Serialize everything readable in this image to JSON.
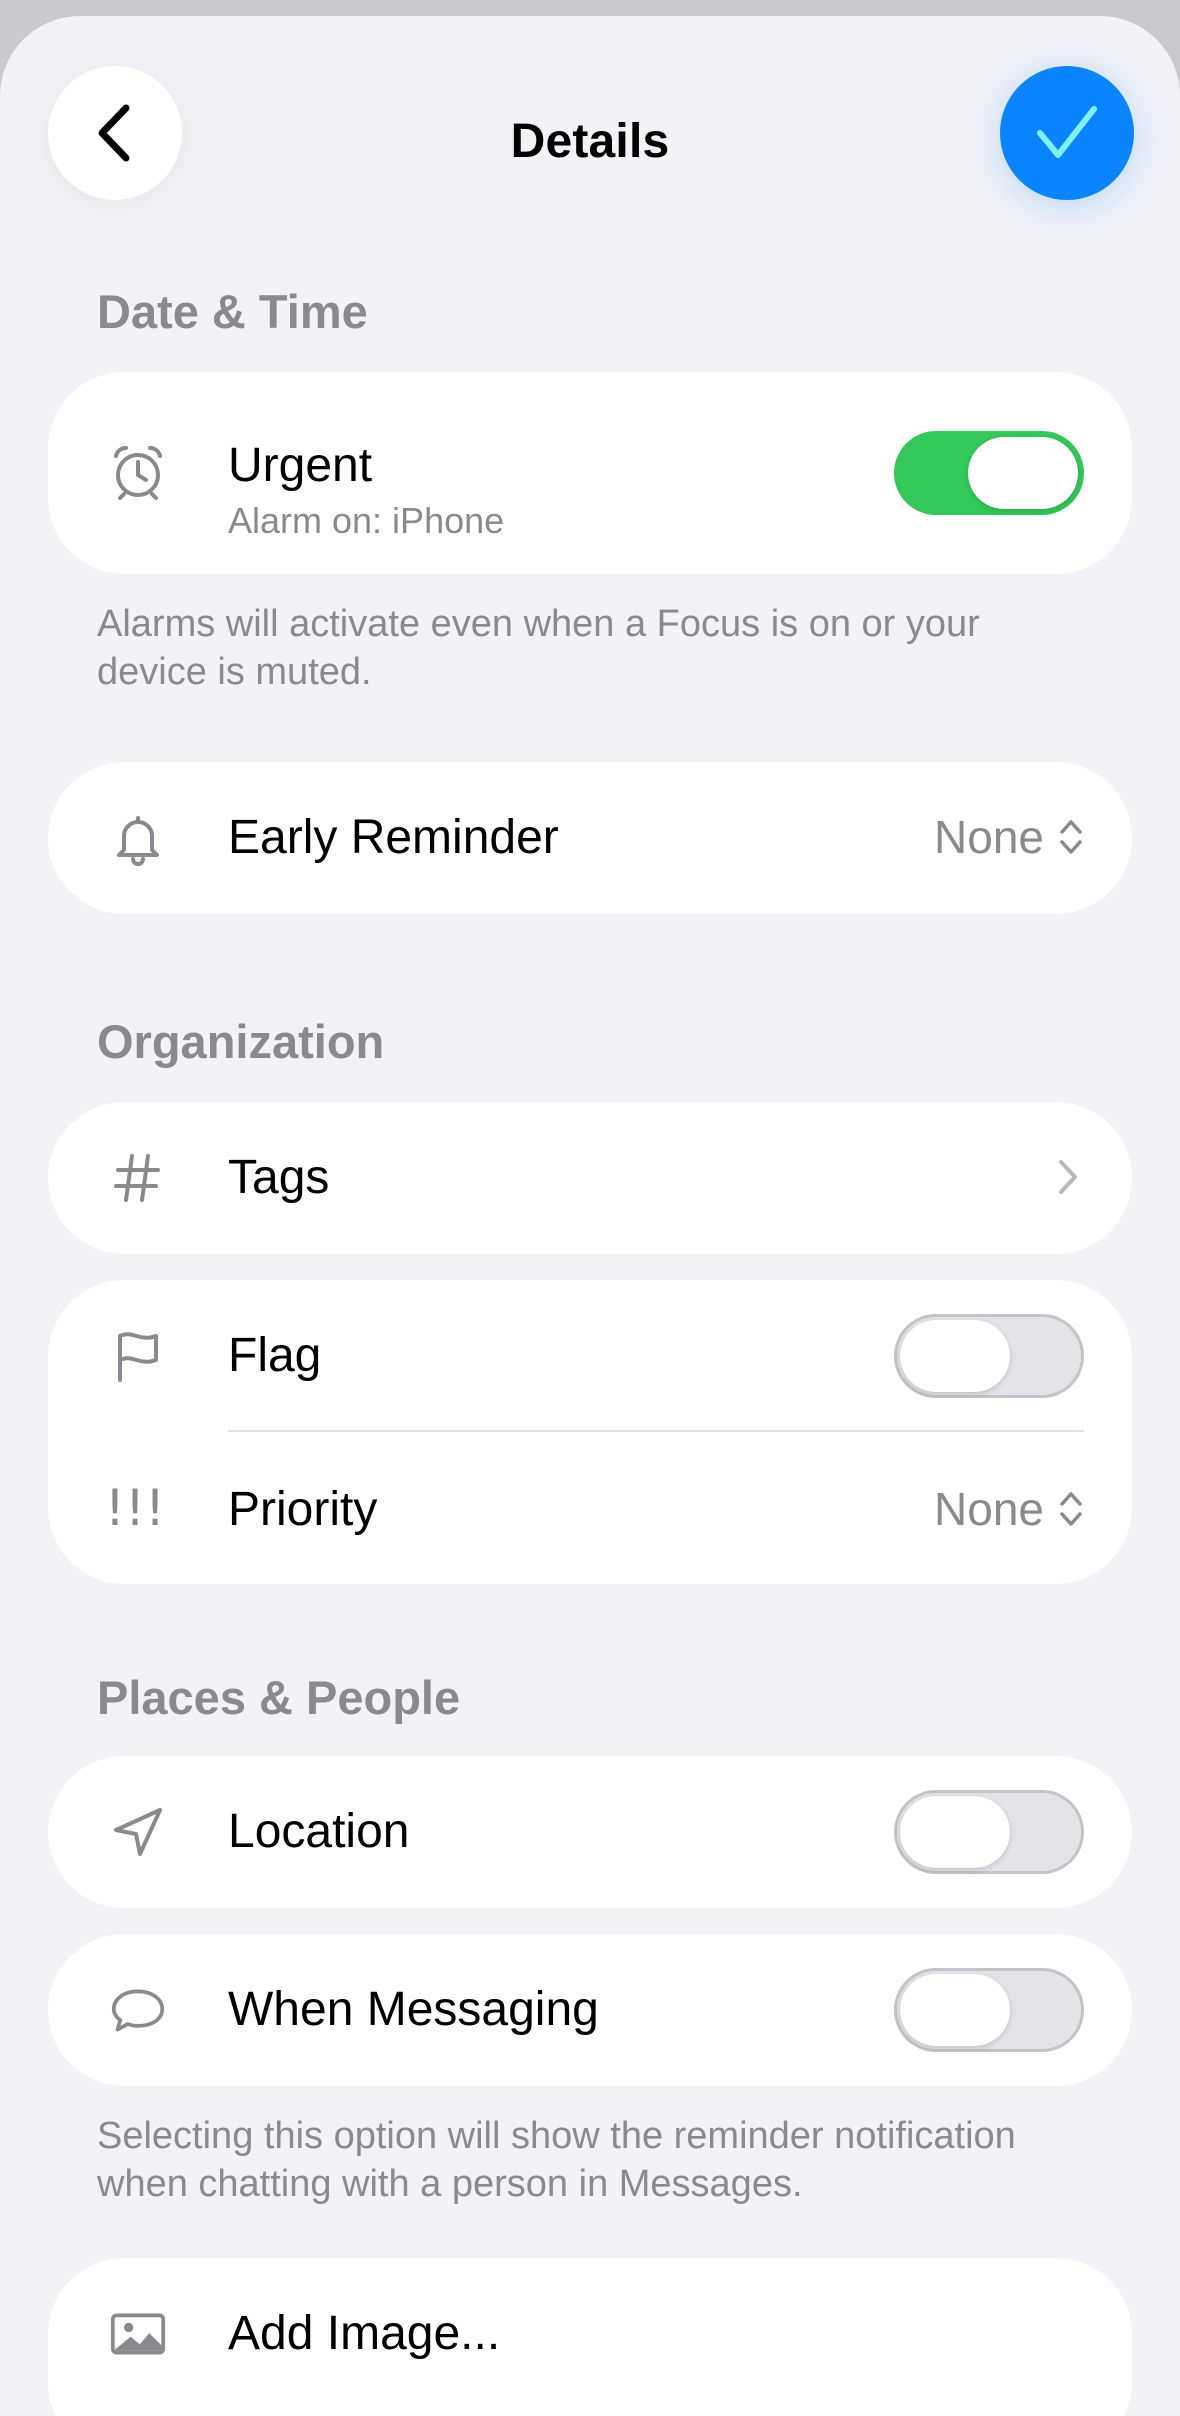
{
  "header": {
    "title": "Details",
    "back_icon": "chevron-left-icon",
    "done_icon": "checkmark-icon",
    "accent": "#0a84ff"
  },
  "sections": {
    "date_time": "Date & Time",
    "organization": "Organization",
    "places_people": "Places & People"
  },
  "urgent": {
    "label": "Urgent",
    "sublabel": "Alarm on: iPhone",
    "icon": "alarm-clock-icon",
    "enabled": true,
    "footnote": "Alarms will activate even when a Focus is on or your device is muted."
  },
  "early_reminder": {
    "label": "Early Reminder",
    "value": "None",
    "icon": "bell-icon"
  },
  "tags": {
    "label": "Tags",
    "icon": "hashtag-icon"
  },
  "flag": {
    "label": "Flag",
    "icon": "flag-icon",
    "enabled": false
  },
  "priority": {
    "label": "Priority",
    "value": "None",
    "icon": "priority-exclamation-icon",
    "icon_text": "!!!"
  },
  "location": {
    "label": "Location",
    "icon": "location-arrow-icon",
    "enabled": false
  },
  "messaging": {
    "label": "When Messaging",
    "icon": "message-bubble-icon",
    "enabled": false,
    "footnote": "Selecting this option will show the reminder notification when chatting with a person in Messages."
  },
  "add_image": {
    "label": "Add Image...",
    "icon": "photo-icon"
  },
  "colors": {
    "toggle_on": "#34c759",
    "secondary_text": "#8a8a8e"
  }
}
